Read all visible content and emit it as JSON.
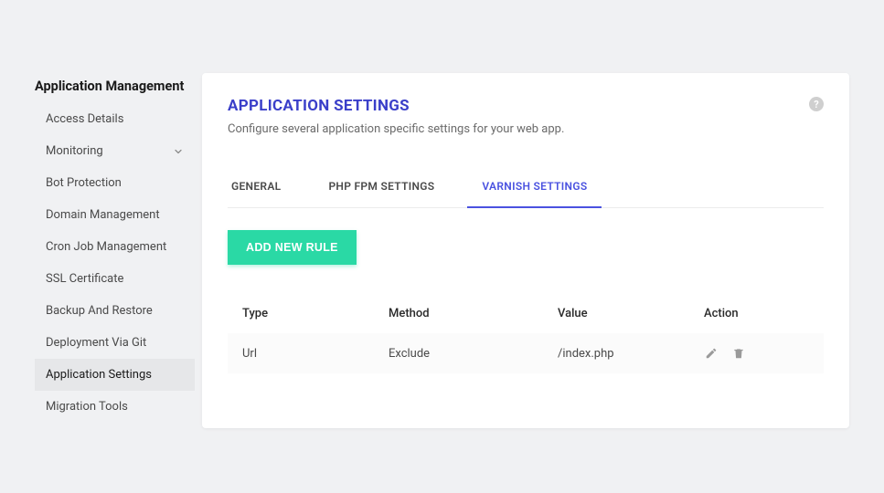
{
  "sidebar": {
    "title": "Application Management",
    "items": [
      {
        "label": "Access Details",
        "expandable": false,
        "active": false
      },
      {
        "label": "Monitoring",
        "expandable": true,
        "active": false
      },
      {
        "label": "Bot Protection",
        "expandable": false,
        "active": false
      },
      {
        "label": "Domain Management",
        "expandable": false,
        "active": false
      },
      {
        "label": "Cron Job Management",
        "expandable": false,
        "active": false
      },
      {
        "label": "SSL Certificate",
        "expandable": false,
        "active": false
      },
      {
        "label": "Backup And Restore",
        "expandable": false,
        "active": false
      },
      {
        "label": "Deployment Via Git",
        "expandable": false,
        "active": false
      },
      {
        "label": "Application Settings",
        "expandable": false,
        "active": true
      },
      {
        "label": "Migration Tools",
        "expandable": false,
        "active": false
      }
    ]
  },
  "main": {
    "title": "APPLICATION SETTINGS",
    "subtitle": "Configure several application specific settings for your web app.",
    "tabs": [
      {
        "label": "GENERAL",
        "active": false
      },
      {
        "label": "PHP FPM SETTINGS",
        "active": false
      },
      {
        "label": "VARNISH SETTINGS",
        "active": true
      }
    ],
    "add_rule_label": "ADD NEW RULE",
    "table": {
      "headers": {
        "type": "Type",
        "method": "Method",
        "value": "Value",
        "action": "Action"
      },
      "rows": [
        {
          "type": "Url",
          "method": "Exclude",
          "value": "/index.php"
        }
      ]
    }
  },
  "colors": {
    "accent_primary": "#4a52e0",
    "accent_button": "#2ad9a5"
  }
}
